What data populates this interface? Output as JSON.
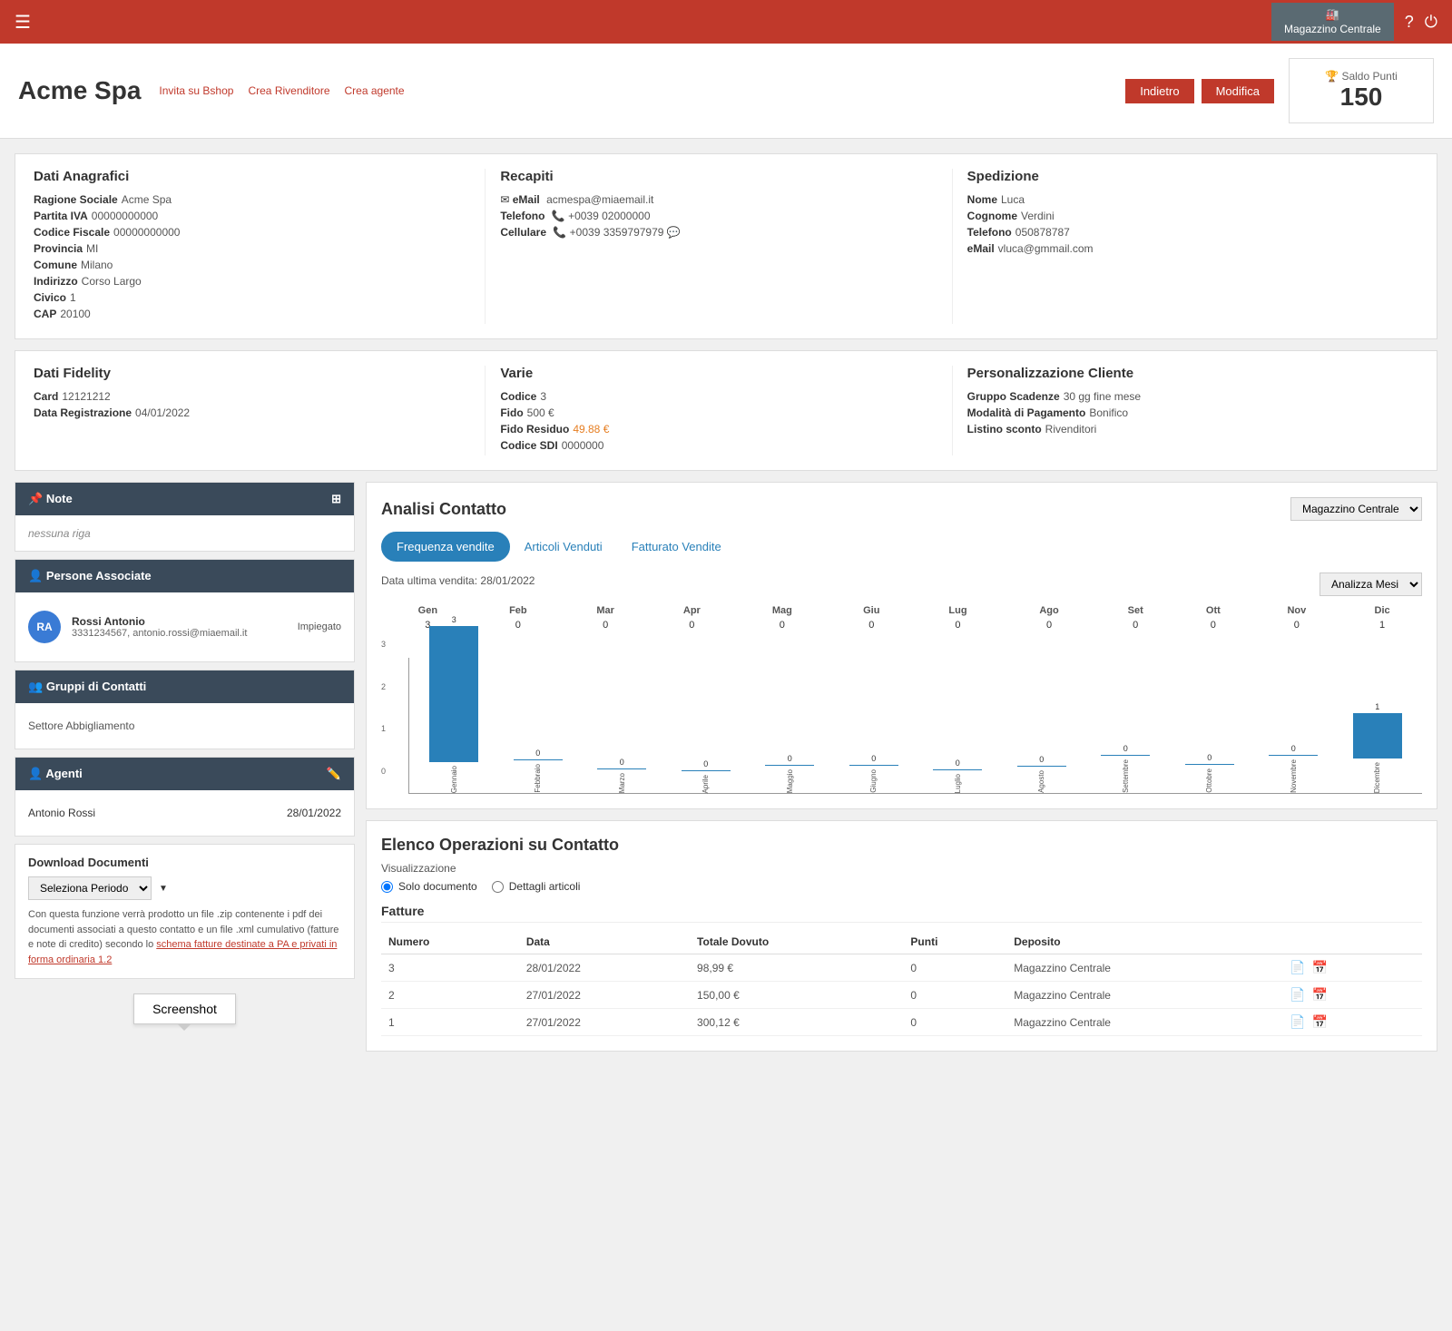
{
  "topbar": {
    "menu_icon": "☰",
    "magazzino_label": "Magazzino Centrale",
    "help_icon": "?",
    "power_icon": "⏻"
  },
  "header": {
    "title": "Acme Spa",
    "invite_label": "Invita su Bshop",
    "crea_rivenditore_label": "Crea Rivenditore",
    "crea_agente_label": "Crea agente",
    "back_button": "Indietro",
    "modify_button": "Modifica",
    "saldo_label": "Saldo Punti",
    "saldo_value": "150"
  },
  "dati_anagrafici": {
    "title": "Dati Anagrafici",
    "ragione_sociale_label": "Ragione Sociale",
    "ragione_sociale_value": "Acme Spa",
    "partita_iva_label": "Partita IVA",
    "partita_iva_value": "00000000000",
    "codice_fiscale_label": "Codice Fiscale",
    "codice_fiscale_value": "00000000000",
    "provincia_label": "Provincia",
    "provincia_value": "MI",
    "comune_label": "Comune",
    "comune_value": "Milano",
    "indirizzo_label": "Indirizzo",
    "indirizzo_value": "Corso Largo",
    "civico_label": "Civico",
    "civico_value": "1",
    "cap_label": "CAP",
    "cap_value": "20100"
  },
  "recapiti": {
    "title": "Recapiti",
    "email_label": "eMail",
    "email_value": "acmespa@miaemail.it",
    "telefono_label": "Telefono",
    "telefono_value": "+0039 02000000",
    "cellulare_label": "Cellulare",
    "cellulare_value": "+0039 3359797979"
  },
  "spedizione": {
    "title": "Spedizione",
    "nome_label": "Nome",
    "nome_value": "Luca",
    "cognome_label": "Cognome",
    "cognome_value": "Verdini",
    "telefono_label": "Telefono",
    "telefono_value": "050878787",
    "email_label": "eMail",
    "email_value": "vluca@gmmail.com"
  },
  "dati_fidelity": {
    "title": "Dati Fidelity",
    "card_label": "Card",
    "card_value": "12121212",
    "data_registrazione_label": "Data Registrazione",
    "data_registrazione_value": "04/01/2022"
  },
  "varie": {
    "title": "Varie",
    "codice_label": "Codice",
    "codice_value": "3",
    "fido_label": "Fido",
    "fido_value": "500 €",
    "fido_residuo_label": "Fido Residuo",
    "fido_residuo_value": "49.88 €",
    "codice_sdi_label": "Codice SDI",
    "codice_sdi_value": "0000000"
  },
  "personalizzazione": {
    "title": "Personalizzazione Cliente",
    "gruppo_scadenze_label": "Gruppo Scadenze",
    "gruppo_scadenze_value": "30 gg fine mese",
    "modalita_pagamento_label": "Modalità di Pagamento",
    "modalita_pagamento_value": "Bonifico",
    "listino_sconto_label": "Listino sconto",
    "listino_sconto_value": "Rivenditori"
  },
  "note": {
    "title": "Note",
    "icon": "📌",
    "add_icon": "⊞",
    "content": "nessuna riga"
  },
  "persone_associate": {
    "title": "Persone Associate",
    "icon": "👤",
    "persons": [
      {
        "initials": "RA",
        "name": "Rossi Antonio",
        "contact": "3331234567, antonio.rossi@miaemail.it",
        "role": "Impiegato"
      }
    ]
  },
  "gruppi_contatti": {
    "title": "Gruppi di Contatti",
    "icon": "👥",
    "groups": [
      "Settore Abbigliamento"
    ]
  },
  "agenti": {
    "title": "Agenti",
    "icon": "👤",
    "edit_icon": "✏️",
    "agents": [
      {
        "name": "Antonio Rossi",
        "date": "28/01/2022"
      }
    ]
  },
  "download": {
    "title": "Download Documenti",
    "select_placeholder": "Seleziona Periodo",
    "note": "Con questa funzione verrà prodotto un file .zip contenente i pdf dei documenti associati a questo contatto e un file .xml cumulativo (fatture e note di credito) secondo lo",
    "link_text": "schema fatture destinate a PA e privati in forma ordinaria 1.2"
  },
  "analisi": {
    "title": "Analisi Contatto",
    "magazzino_option": "Magazzino Centrale",
    "tabs": [
      {
        "label": "Frequenza vendite",
        "active": true
      },
      {
        "label": "Articoli Venduti",
        "active": false
      },
      {
        "label": "Fatturato Vendite",
        "active": false
      }
    ],
    "data_ultima_vendita_label": "Data ultima vendita:",
    "data_ultima_vendita_value": "28/01/2022",
    "analizza_mesi_option": "Analizza Mesi",
    "months": [
      "Gen",
      "Feb",
      "Mar",
      "Apr",
      "Mag",
      "Giu",
      "Lug",
      "Ago",
      "Set",
      "Ott",
      "Nov",
      "Dic"
    ],
    "month_values": [
      3,
      0,
      0,
      0,
      0,
      0,
      0,
      0,
      0,
      0,
      0,
      1
    ],
    "month_labels_long": [
      "Gennaio",
      "Febbraio",
      "Marzo",
      "Aprile",
      "Maggio",
      "Giugno",
      "Luglio",
      "Agosto",
      "Settembre",
      "Ottobre",
      "Novembre",
      "Dicembre"
    ],
    "y_max": 3
  },
  "elenco_operazioni": {
    "title": "Elenco Operazioni su Contatto",
    "visualizzazione_label": "Visualizzazione",
    "radio_solo": "Solo documento",
    "radio_dettagli": "Dettagli articoli",
    "fatture_title": "Fatture",
    "columns": [
      "Numero",
      "Data",
      "Totale Dovuto",
      "Punti",
      "Deposito"
    ],
    "rows": [
      {
        "numero": "3",
        "data": "28/01/2022",
        "totale": "98,99 €",
        "punti": "0",
        "deposito": "Magazzino Centrale"
      },
      {
        "numero": "2",
        "data": "27/01/2022",
        "totale": "150,00 €",
        "punti": "0",
        "deposito": "Magazzino Centrale"
      },
      {
        "numero": "1",
        "data": "27/01/2022",
        "totale": "300,12 €",
        "punti": "0",
        "deposito": "Magazzino Centrale"
      }
    ]
  },
  "screenshot_button": "Screenshot"
}
